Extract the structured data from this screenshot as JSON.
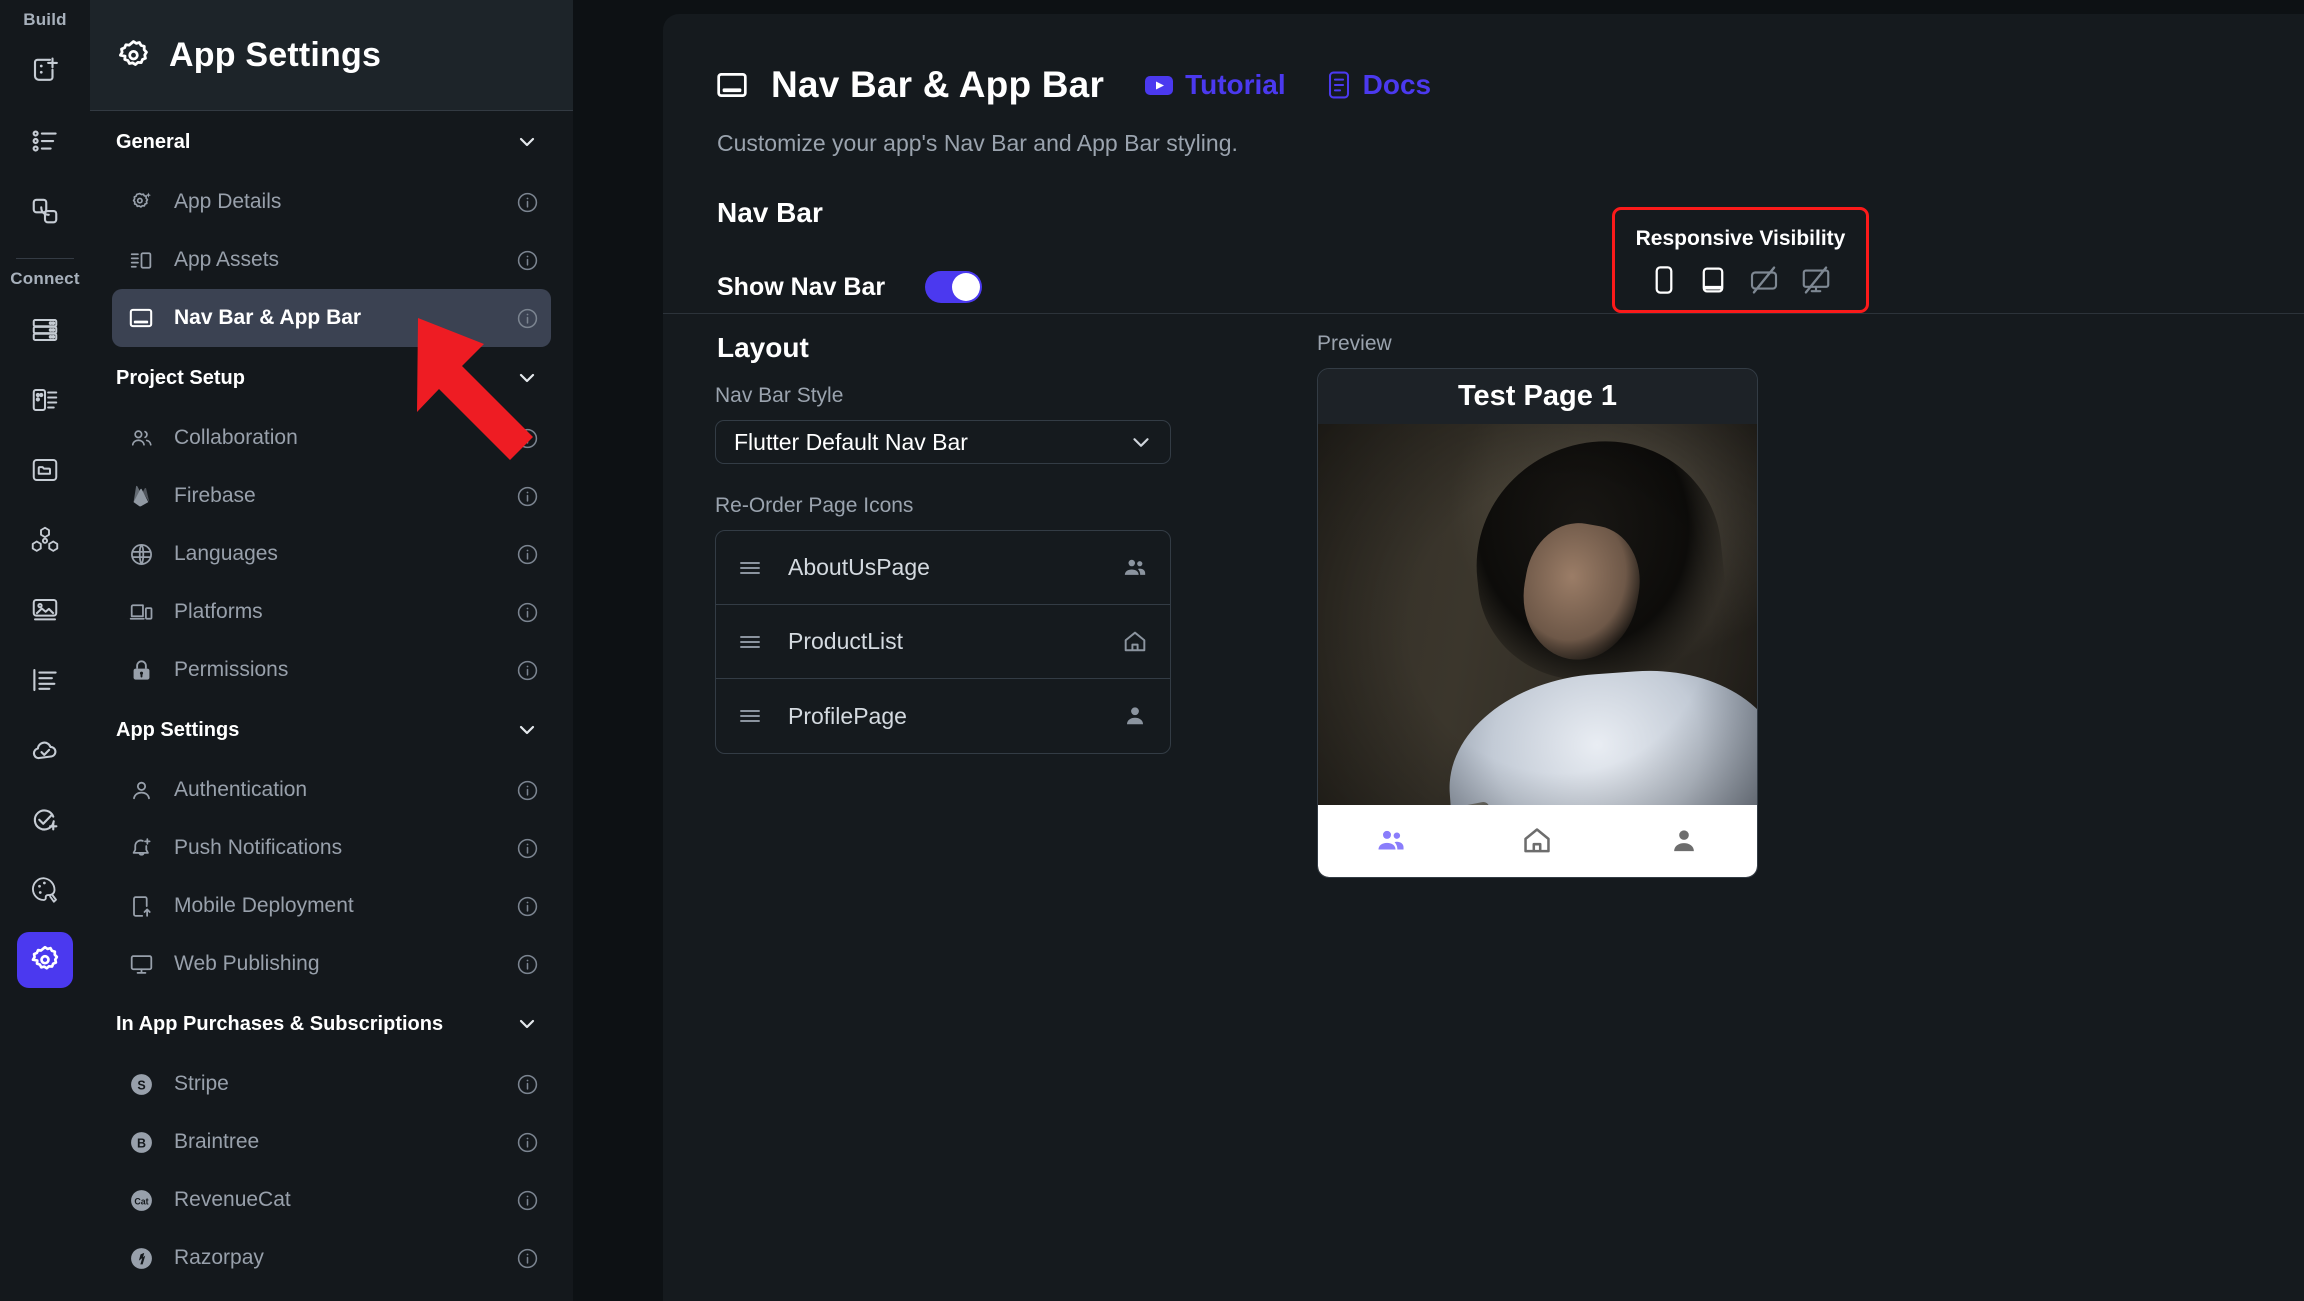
{
  "rail": {
    "groups": [
      {
        "label": "Build",
        "items": [
          {
            "name": "add-page-icon"
          },
          {
            "name": "page-list-icon"
          },
          {
            "name": "components-icon"
          }
        ]
      },
      {
        "label": "Connect",
        "items": [
          {
            "name": "database-icon"
          },
          {
            "name": "api-calls-icon"
          },
          {
            "name": "media-folder-icon"
          },
          {
            "name": "integrations-icon"
          },
          {
            "name": "media-assets-icon"
          },
          {
            "name": "localization-icon"
          },
          {
            "name": "deploy-cloud-icon"
          },
          {
            "name": "tests-icon"
          },
          {
            "name": "theme-palette-icon"
          },
          {
            "name": "settings-gear-icon"
          }
        ]
      }
    ]
  },
  "sidebar": {
    "title": "App Settings",
    "title_icon": "gear-icon",
    "groups": [
      {
        "label": "General",
        "items": [
          {
            "label": "App Details",
            "icon": "gear-sparkle-icon",
            "active": false
          },
          {
            "label": "App Assets",
            "icon": "assets-icon",
            "active": false
          },
          {
            "label": "Nav Bar & App Bar",
            "icon": "navbar-icon",
            "active": true
          }
        ]
      },
      {
        "label": "Project Setup",
        "items": [
          {
            "label": "Collaboration",
            "icon": "people-icon",
            "active": false
          },
          {
            "label": "Firebase",
            "icon": "firebase-icon",
            "active": false
          },
          {
            "label": "Languages",
            "icon": "globe-icon",
            "active": false
          },
          {
            "label": "Platforms",
            "icon": "platforms-icon",
            "active": false
          },
          {
            "label": "Permissions",
            "icon": "lock-icon",
            "active": false
          }
        ]
      },
      {
        "label": "App Settings",
        "items": [
          {
            "label": "Authentication",
            "icon": "person-icon",
            "active": false
          },
          {
            "label": "Push Notifications",
            "icon": "bell-plus-icon",
            "active": false
          },
          {
            "label": "Mobile Deployment",
            "icon": "mobile-upload-icon",
            "active": false
          },
          {
            "label": "Web Publishing",
            "icon": "monitor-icon",
            "active": false
          }
        ]
      },
      {
        "label": "In App Purchases & Subscriptions",
        "items": [
          {
            "label": "Stripe",
            "icon": "stripe-icon",
            "active": false
          },
          {
            "label": "Braintree",
            "icon": "braintree-icon",
            "active": false
          },
          {
            "label": "RevenueCat",
            "icon": "revenuecat-icon",
            "active": false
          },
          {
            "label": "Razorpay",
            "icon": "razorpay-icon",
            "active": false
          }
        ]
      }
    ]
  },
  "panel": {
    "title": "Nav Bar & App Bar",
    "title_icon": "navbar-icon",
    "tutorial_label": "Tutorial",
    "tutorial_icon": "youtube-play-icon",
    "docs_label": "Docs",
    "docs_icon": "docs-page-icon",
    "subtitle": "Customize your app's Nav Bar and App Bar styling.",
    "navbar_section_title": "Nav Bar",
    "show_navbar_label": "Show Nav Bar",
    "show_navbar_on": true,
    "responsive": {
      "title": "Responsive Visibility",
      "highlight_color": "#fb1a1a",
      "devices": [
        {
          "name": "phone-icon",
          "enabled": true
        },
        {
          "name": "tablet-icon",
          "enabled": true
        },
        {
          "name": "tablet-landscape-off-icon",
          "enabled": false
        },
        {
          "name": "desktop-off-icon",
          "enabled": false
        }
      ]
    },
    "layout_section_title": "Layout",
    "navbar_style_label": "Nav Bar Style",
    "navbar_style_value": "Flutter Default Nav Bar",
    "reorder_label": "Re-Order Page Icons",
    "reorder_rows": [
      {
        "name": "AboutUsPage",
        "icon": "people-icon"
      },
      {
        "name": "ProductList",
        "icon": "home-icon"
      },
      {
        "name": "ProfilePage",
        "icon": "person-icon"
      }
    ],
    "preview_label": "Preview",
    "preview_appbar_title": "Test Page 1",
    "preview_navbar_items": [
      {
        "icon": "people-icon",
        "selected": true
      },
      {
        "icon": "home-icon",
        "selected": false
      },
      {
        "icon": "person-icon",
        "selected": false
      }
    ]
  },
  "annotation": {
    "arrow_color": "#ee1c23",
    "arrow_target": "sidebar-item-nav-bar-app-bar"
  },
  "colors": {
    "accent": "#4b39ef",
    "panel_bg": "#151a1e",
    "sidebar_bg": "#14181c",
    "highlight_red": "#fb1a1a"
  }
}
